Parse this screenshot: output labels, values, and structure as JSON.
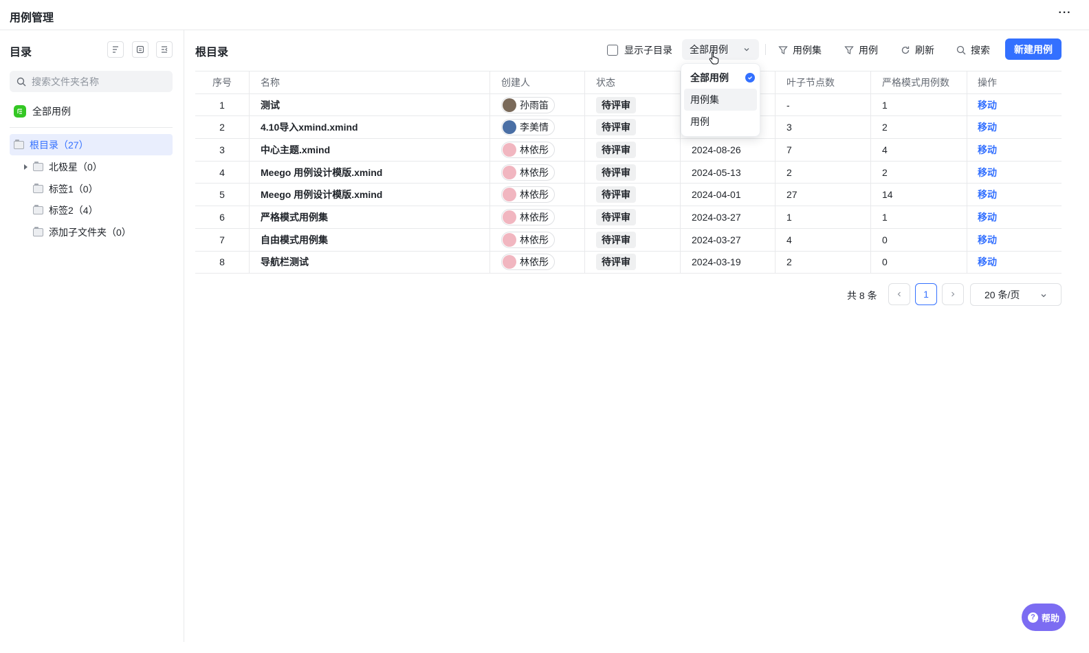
{
  "app": {
    "title": "用例管理"
  },
  "sidebar": {
    "title": "目录",
    "search_placeholder": "搜索文件夹名称",
    "all_cases": "全部用例",
    "tree": {
      "root": "根目录（27）",
      "children": [
        "北极星（0）",
        "标签1（0）",
        "标签2（4）",
        "添加子文件夹（0）"
      ]
    }
  },
  "main": {
    "title": "根目录",
    "show_subdir": "显示子目录",
    "filter_selected": "全部用例",
    "toolbar": {
      "filter_case_set": "用例集",
      "filter_case": "用例",
      "refresh": "刷新",
      "search": "搜索",
      "new_case": "新建用例"
    },
    "dropdown": {
      "options": [
        "全部用例",
        "用例集",
        "用例"
      ]
    },
    "table": {
      "columns": [
        "序号",
        "名称",
        "创建人",
        "状态",
        "",
        "叶子节点数",
        "严格模式用例数",
        "操作"
      ],
      "rows": [
        {
          "no": "1",
          "name": "测试",
          "creator": "孙雨笛",
          "status": "待评审",
          "date": "",
          "leaves": "-",
          "strict": "1",
          "op": "移动"
        },
        {
          "no": "2",
          "name": "4.10导入xmind.xmind",
          "creator": "李美情",
          "status": "待评审",
          "date": "",
          "leaves": "3",
          "strict": "2",
          "op": "移动"
        },
        {
          "no": "3",
          "name": "中心主题.xmind",
          "creator": "林依彤",
          "status": "待评审",
          "date": "2024-08-26",
          "leaves": "7",
          "strict": "4",
          "op": "移动"
        },
        {
          "no": "4",
          "name": "Meego 用例设计模版.xmind",
          "creator": "林依彤",
          "status": "待评审",
          "date": "2024-05-13",
          "leaves": "2",
          "strict": "2",
          "op": "移动"
        },
        {
          "no": "5",
          "name": "Meego 用例设计模版.xmind",
          "creator": "林依彤",
          "status": "待评审",
          "date": "2024-04-01",
          "leaves": "27",
          "strict": "14",
          "op": "移动"
        },
        {
          "no": "6",
          "name": "严格模式用例集",
          "creator": "林依彤",
          "status": "待评审",
          "date": "2024-03-27",
          "leaves": "1",
          "strict": "1",
          "op": "移动"
        },
        {
          "no": "7",
          "name": "自由模式用例集",
          "creator": "林依彤",
          "status": "待评审",
          "date": "2024-03-27",
          "leaves": "4",
          "strict": "0",
          "op": "移动"
        },
        {
          "no": "8",
          "name": "导航栏测试",
          "creator": "林依彤",
          "status": "待评审",
          "date": "2024-03-19",
          "leaves": "2",
          "strict": "0",
          "op": "移动"
        }
      ]
    },
    "pagination": {
      "total": "共 8 条",
      "current": "1",
      "page_size": "20 条/页"
    }
  },
  "help": {
    "label": "帮助"
  },
  "colors": {
    "primary": "#3370ff",
    "help": "#7c6cf2",
    "folder_green": "#34c724"
  }
}
